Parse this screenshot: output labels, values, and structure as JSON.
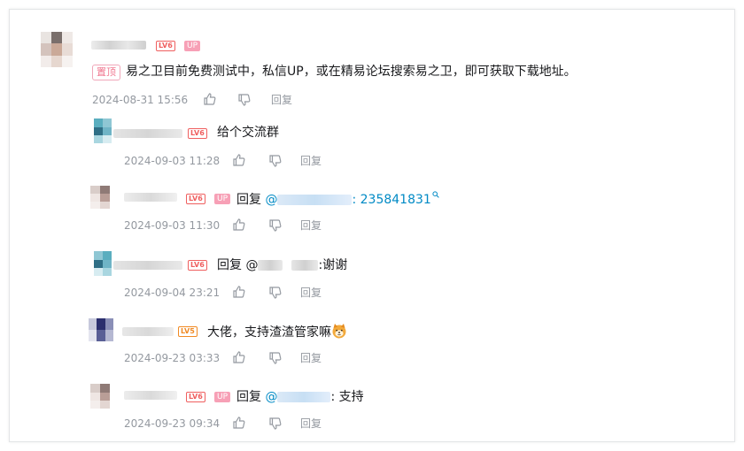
{
  "colors": {
    "accent_link": "#008ac5",
    "level_badge": "#ef5f5f",
    "up_badge": "#f7a0b6",
    "meta_gray": "#9499a0"
  },
  "icons": {
    "like": "thumbs-up-icon",
    "dislike": "thumbs-down-icon",
    "search": "search-icon",
    "emoji": "dog-emoji"
  },
  "root": {
    "level": "LV6",
    "up_badge": "UP",
    "pinned_label": "置顶",
    "content": "易之卫目前免费测试中，私信UP，或在精易论坛搜索易之卫，即可获取下载地址。",
    "time": "2024-08-31 15:56",
    "reply_label": "回复"
  },
  "replies": [
    {
      "level": "LV6",
      "content": "给个交流群",
      "time": "2024-09-03 11:28",
      "reply_label": "回复"
    },
    {
      "level": "LV6",
      "up_badge": "UP",
      "prefix": "回复 ",
      "at": "@",
      "sep": ": ",
      "content_link": "235841831",
      "time": "2024-09-03 11:30",
      "reply_label": "回复"
    },
    {
      "level": "LV6",
      "prefix": "回复 @",
      "content": ":谢谢",
      "time": "2024-09-04 23:21",
      "reply_label": "回复"
    },
    {
      "level": "LV5",
      "content": "大佬，支持渣渣管家嘛",
      "time": "2024-09-23 03:33",
      "reply_label": "回复"
    },
    {
      "level": "LV6",
      "up_badge": "UP",
      "prefix": "回复 ",
      "at": "@",
      "content": ": 支持",
      "time": "2024-09-23 09:34",
      "reply_label": "回复"
    }
  ]
}
